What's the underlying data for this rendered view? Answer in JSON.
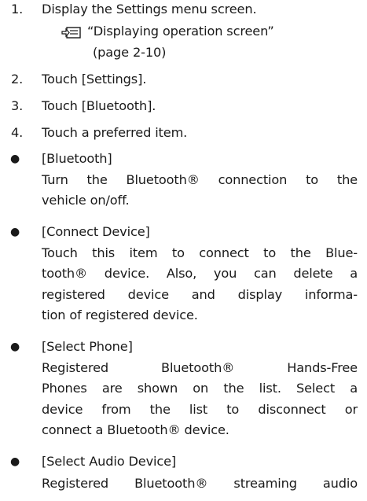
{
  "steps": [
    {
      "num": "1.",
      "text": "Display the Settings menu screen."
    },
    {
      "num": "2.",
      "text": "Touch [Settings]."
    },
    {
      "num": "3.",
      "text": "Touch [Bluetooth]."
    },
    {
      "num": "4.",
      "text": "Touch a preferred item."
    }
  ],
  "reference": {
    "icon": "reference-pointer-icon",
    "text": "“Displaying operation screen”",
    "page": "(page 2-10)"
  },
  "bullet_symbol": "●",
  "items": [
    {
      "title": "[Bluetooth]",
      "lines": [
        "Turn the Bluetooth® connection to the",
        "vehicle on/off."
      ]
    },
    {
      "title": "[Connect Device]",
      "lines": [
        "Touch this item to connect to the Blue-",
        "tooth® device. Also, you can delete a",
        "registered device and display informa-",
        "tion of registered device."
      ]
    },
    {
      "title": "[Select Phone]",
      "lines": [
        "Registered Bluetooth® Hands-Free",
        "Phones are shown on the list. Select a",
        "device from the list to disconnect or",
        "connect a Bluetooth® device."
      ]
    },
    {
      "title": "[Select Audio Device]",
      "lines": [
        "Registered Bluetooth® streaming audio"
      ]
    }
  ]
}
